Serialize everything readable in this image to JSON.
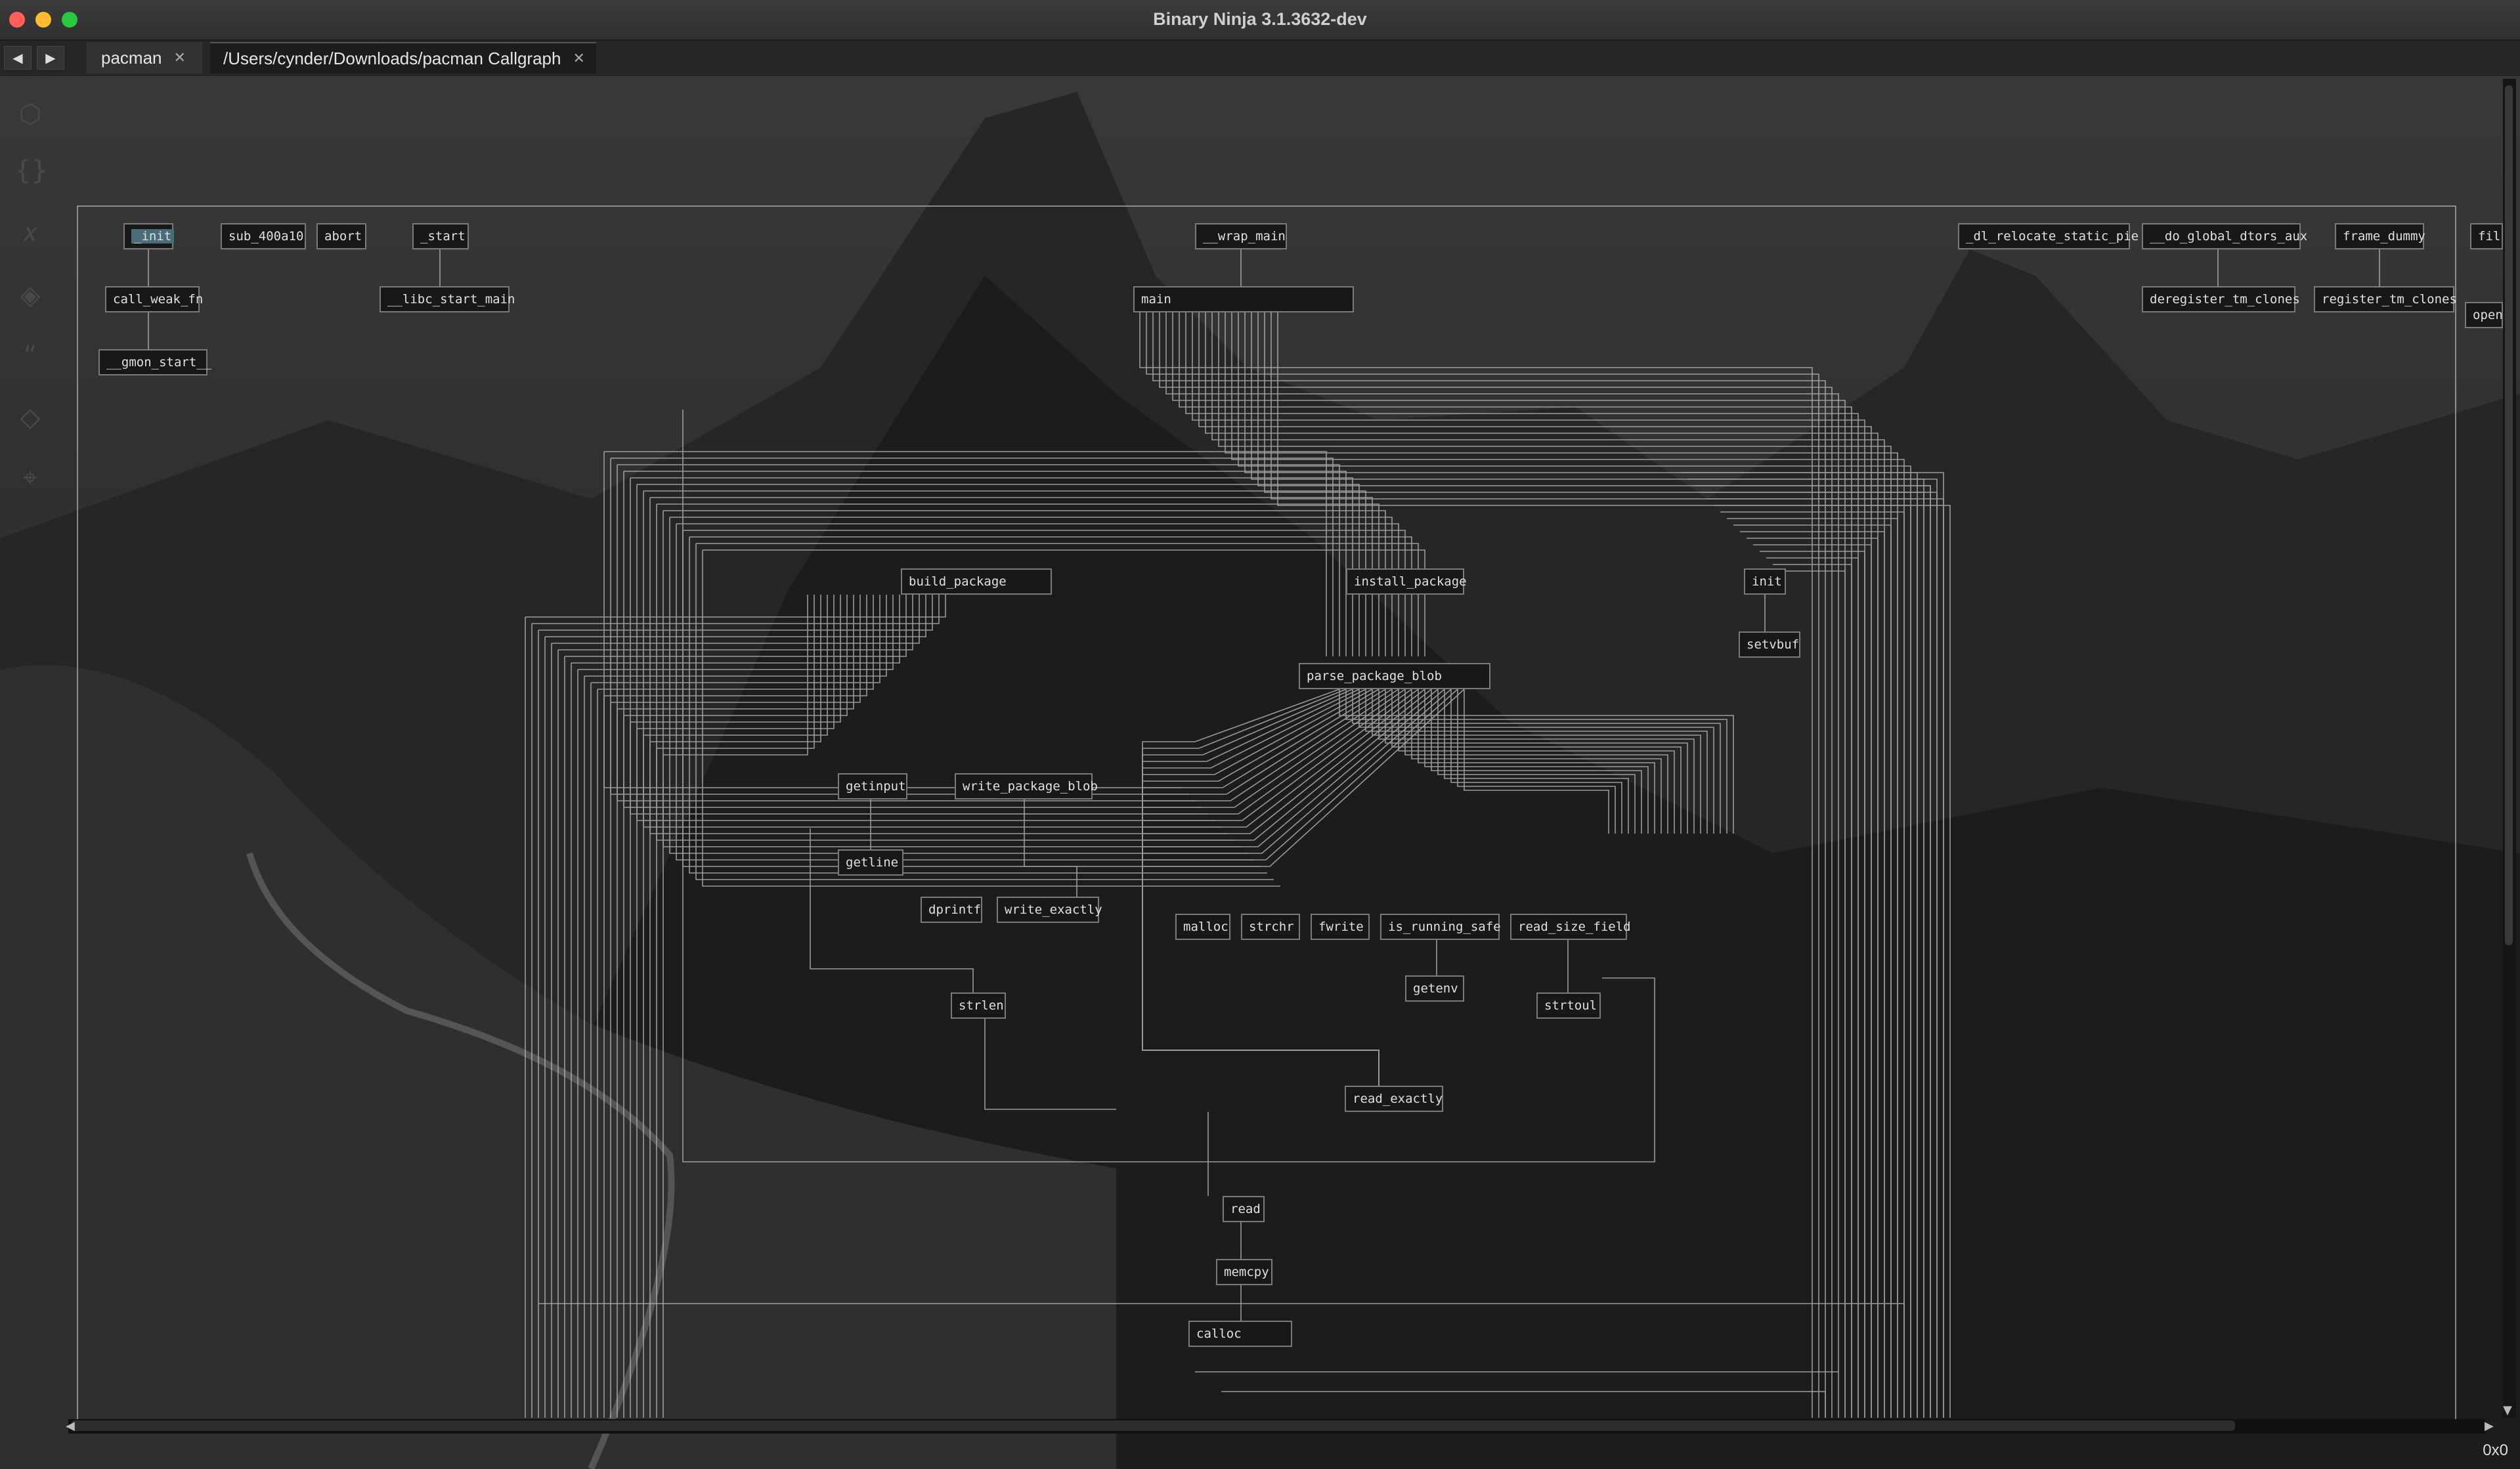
{
  "window": {
    "title": "Binary Ninja 3.1.3632-dev"
  },
  "nav": {
    "back": "◀",
    "forward": "▶"
  },
  "tabs": [
    {
      "label": "pacman",
      "close": "✕"
    },
    {
      "label": "/Users/cynder/Downloads/pacman Callgraph",
      "close": "✕"
    }
  ],
  "sidebar": {
    "icons": [
      "hex-icon",
      "braces-icon",
      "variable-icon",
      "layers-icon",
      "quote-icon",
      "tag-icon",
      "pin-icon"
    ]
  },
  "graph": {
    "nodes": {
      "init_u": "_init",
      "sub_400a10": "sub_400a10",
      "abort": "abort",
      "start": "_start",
      "wrap_main": "__wrap_main",
      "dl_relocate": "_dl_relocate_static_pie",
      "do_global_dtors": "__do_global_dtors_aux",
      "frame_dummy": "frame_dummy",
      "fil": "fil",
      "call_weak_fn": "call_weak_fn",
      "libc_start_main": "__libc_start_main",
      "main": "main",
      "deregister": "deregister_tm_clones",
      "register": "register_tm_clones",
      "open": "open",
      "gmon_start": "__gmon_start__",
      "build_package": "build_package",
      "install_package": "install_package",
      "init": "init",
      "setvbuf": "setvbuf",
      "parse_package_blob": "parse_package_blob",
      "getinput": "getinput",
      "write_package_blob": "write_package_blob",
      "getline": "getline",
      "dprintf": "dprintf",
      "write_exactly": "write_exactly",
      "malloc": "malloc",
      "strchr": "strchr",
      "fwrite": "fwrite",
      "is_running_safe": "is_running_safe",
      "read_size_field": "read_size_field",
      "strlen": "strlen",
      "getenv": "getenv",
      "strtoul": "strtoul",
      "read_exactly": "read_exactly",
      "read": "read",
      "memcpy": "memcpy",
      "calloc": "calloc"
    }
  },
  "status": {
    "address": "0x0"
  }
}
